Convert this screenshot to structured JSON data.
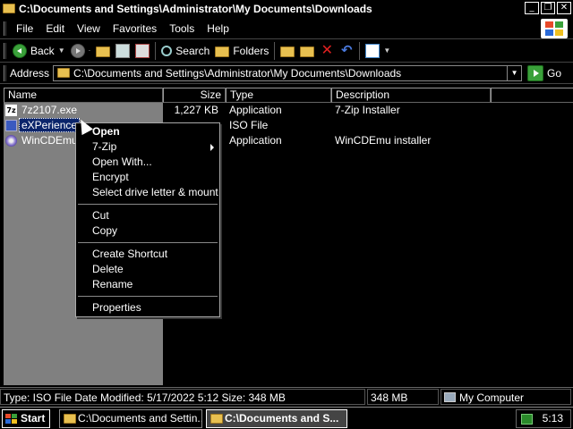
{
  "window": {
    "title": "C:\\Documents and Settings\\Administrator\\My Documents\\Downloads",
    "buttons": {
      "minimize": "_",
      "maximize": "❐",
      "close": "✕"
    }
  },
  "menubar": {
    "items": [
      "File",
      "Edit",
      "View",
      "Favorites",
      "Tools",
      "Help"
    ]
  },
  "toolbar": {
    "back_label": "Back",
    "search_label": "Search",
    "folders_label": "Folders"
  },
  "address": {
    "label": "Address",
    "value": "C:\\Documents and Settings\\Administrator\\My Documents\\Downloads",
    "go_label": "Go"
  },
  "columns": {
    "name": "Name",
    "size": "Size",
    "type": "Type",
    "description": "Description"
  },
  "files": [
    {
      "name": "7z2107.exe",
      "size": "1,227 KB",
      "type": "Application",
      "description": "7-Zip Installer",
      "icon": "7zip-icon"
    },
    {
      "name": "eXPerience",
      "size": "",
      "type": "ISO File",
      "description": "",
      "icon": "iso-file-icon"
    },
    {
      "name": "WinCDEmu-",
      "size": "",
      "type": "Application",
      "description": "WinCDEmu installer",
      "icon": "cd-installer-icon"
    }
  ],
  "context_menu": {
    "items": [
      {
        "label": "Open",
        "bold": true
      },
      {
        "label": "7-Zip",
        "submenu": true
      },
      {
        "label": "Open With..."
      },
      {
        "label": "Encrypt"
      },
      {
        "label": "Select drive letter & mount"
      },
      {
        "label": "Cut"
      },
      {
        "label": "Copy"
      },
      {
        "label": "Create Shortcut"
      },
      {
        "label": "Delete"
      },
      {
        "label": "Rename"
      },
      {
        "label": "Properties"
      }
    ]
  },
  "statusbar": {
    "info": "Type: ISO File Date Modified: 5/17/2022 5:12 Size: 348 MB",
    "size": "348 MB",
    "zone": "My Computer"
  },
  "taskbar": {
    "start_label": "Start",
    "tasks": [
      {
        "label": "C:\\Documents and Settin...",
        "active": false
      },
      {
        "label": "C:\\Documents and S...",
        "active": true
      }
    ],
    "clock": "5:13"
  },
  "colors": {
    "background": "#000000",
    "selection": "#0a246a",
    "name_column_bg": "#808080",
    "go_green": "#3aa03a",
    "folder_yellow": "#e8c050"
  }
}
